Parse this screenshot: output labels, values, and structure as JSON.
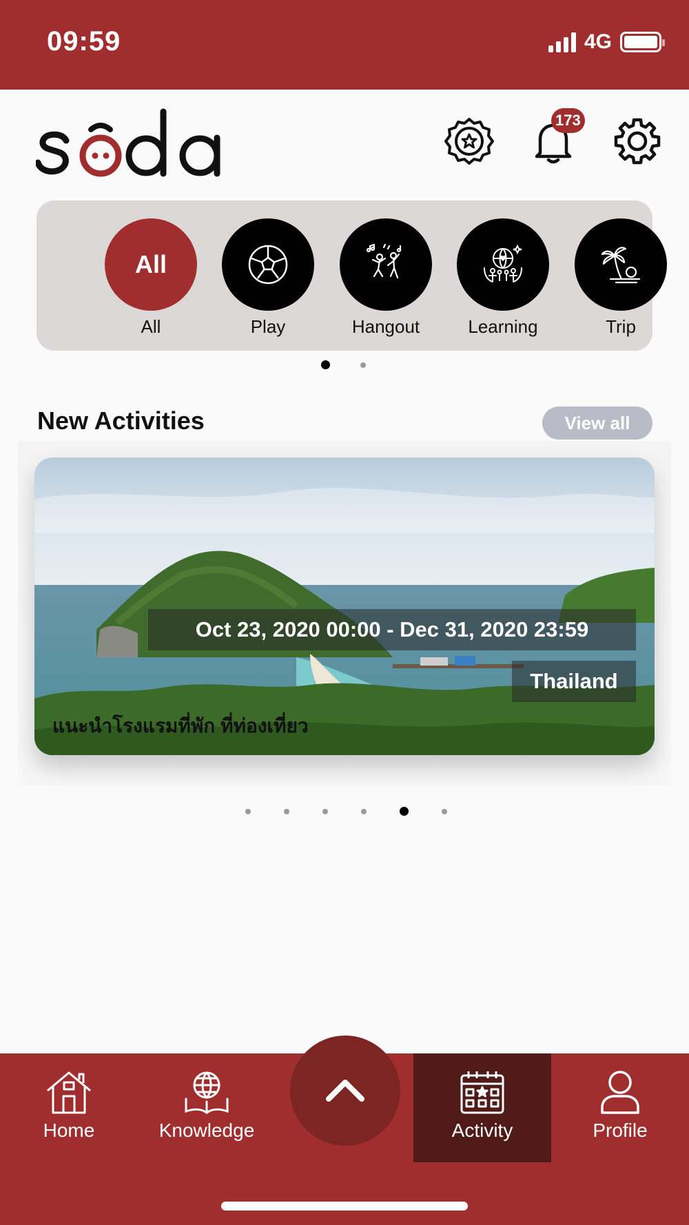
{
  "status_bar": {
    "time": "09:59",
    "network": "4G"
  },
  "header": {
    "logo_icon": "soda-logo",
    "badge_icon": "star-badge-icon",
    "notifications_icon": "bell-icon",
    "notification_count": "173",
    "settings_icon": "gear-icon"
  },
  "categories": [
    {
      "label": "All",
      "circle_text": "All",
      "icon": "",
      "active": true
    },
    {
      "label": "Play",
      "icon": "soccer-ball-icon",
      "active": false
    },
    {
      "label": "Hangout",
      "icon": "dancing-people-icon",
      "active": false
    },
    {
      "label": "Learning",
      "icon": "globe-family-icon",
      "active": false
    },
    {
      "label": "Trip",
      "icon": "palm-tree-icon",
      "active": false
    }
  ],
  "category_pager": {
    "pages": 2,
    "current": 1
  },
  "new_activities": {
    "title": "New Activities",
    "view_all_label": "View all",
    "card": {
      "date_range": "Oct 23, 2020 00:00 - Dec 31, 2020 23:59",
      "location": "Thailand",
      "title": "แนะนำโรงแรมที่พัก ที่ท่องเที่ยว"
    },
    "pager": {
      "pages": 6,
      "current": 5
    }
  },
  "bottom_nav": {
    "items": [
      {
        "label": "Home",
        "icon": "house-icon",
        "active": false
      },
      {
        "label": "Knowledge",
        "icon": "globe-book-icon",
        "active": false
      },
      {
        "label": "Activity",
        "icon": "calendar-star-icon",
        "active": true
      },
      {
        "label": "Profile",
        "icon": "person-icon",
        "active": false
      }
    ],
    "center_button_icon": "chevron-up-icon"
  },
  "colors": {
    "brand": "#a12e2e",
    "brand_dark": "#4f1a17",
    "category_panel": "#dcd8d8",
    "view_all": "#b9bcc7"
  }
}
